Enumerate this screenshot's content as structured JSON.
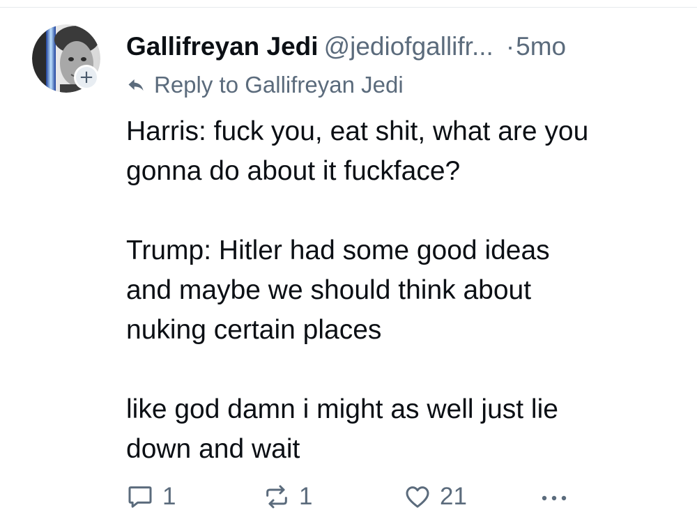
{
  "post": {
    "author": {
      "display_name": "Gallifreyan Jedi",
      "handle": "@jediofgallifr...",
      "timestamp": "5mo",
      "separator": "·",
      "follow_badge": "+"
    },
    "reply_to": {
      "label": "Reply to Gallifreyan Jedi",
      "icon": "reply-arrow-icon"
    },
    "paragraphs": [
      "Harris: fuck you, eat shit, what are you\ngonna do about it fuckface?",
      "Trump: Hitler had some good ideas\nand maybe we should think about\nnuking certain places",
      "like god damn i might as well just lie\ndown and wait"
    ],
    "actions": {
      "reply_count": "1",
      "repost_count": "1",
      "like_count": "21",
      "more_icon": "ellipsis-icon"
    }
  },
  "colors": {
    "text_primary": "#0b0f14",
    "text_secondary": "#5b6b7c",
    "badge_bg": "#e8edf2",
    "divider": "#e6e9ed"
  }
}
